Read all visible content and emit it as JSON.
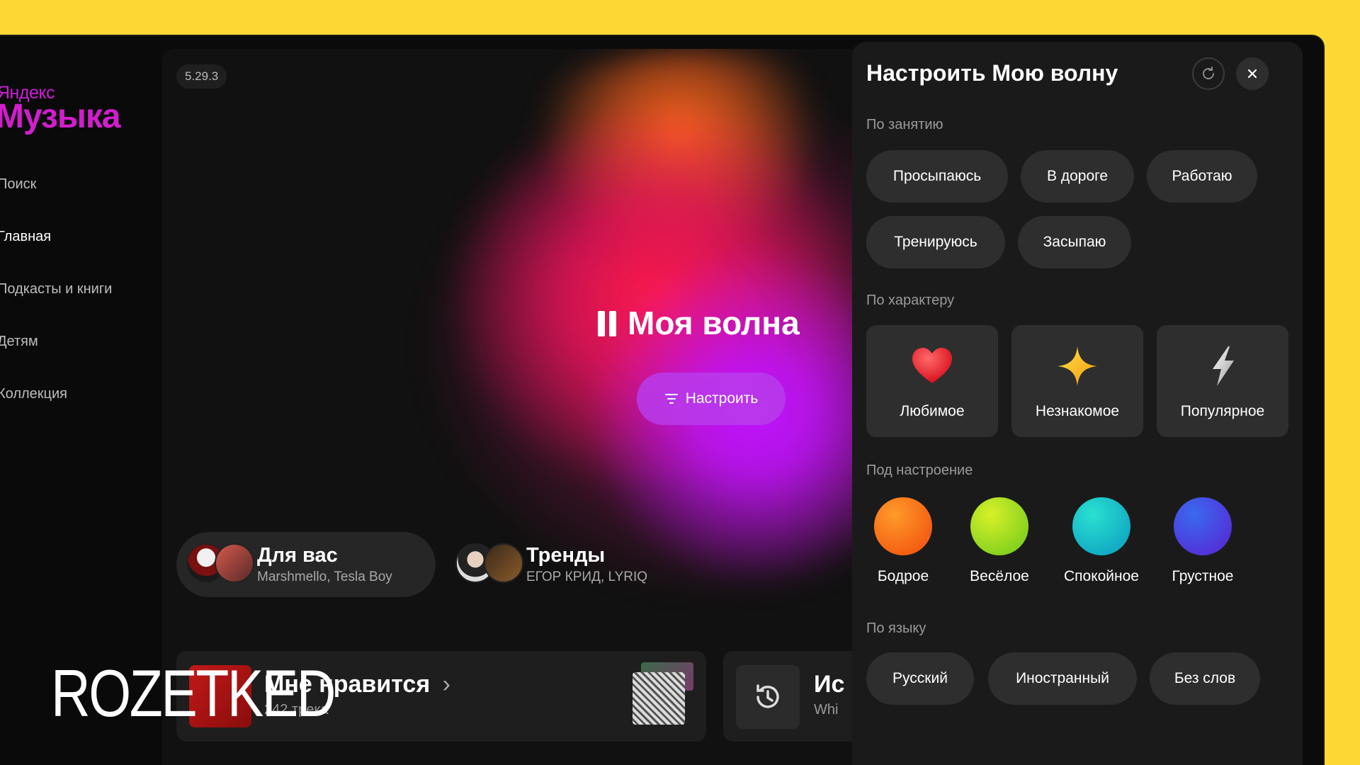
{
  "app": {
    "logo_top": "Яндекс",
    "logo_bottom": "Музыка",
    "version": "5.29.3"
  },
  "sidebar": {
    "items": [
      {
        "label": "Поиск",
        "active": false
      },
      {
        "label": "Главная",
        "active": true
      },
      {
        "label": "Подкасты и книги",
        "active": false
      },
      {
        "label": "Детям",
        "active": false
      },
      {
        "label": "Коллекция",
        "active": false
      }
    ]
  },
  "main": {
    "wave_title": "Моя волна",
    "tune_label": "Настроить",
    "for_you": {
      "title": "Для вас",
      "subtitle": "Marshmello, Tesla Boy"
    },
    "trends": {
      "title": "Тренды",
      "subtitle": "ЕГОР КРИД, LYRIQ"
    },
    "liked": {
      "title": "Мне нравится",
      "subtitle": "242 трека"
    },
    "history": {
      "title": "Ис",
      "subtitle": "Whi"
    }
  },
  "panel": {
    "title": "Настроить Мою волну",
    "sections": {
      "activity": {
        "label": "По занятию",
        "items": [
          "Просыпаюсь",
          "В дороге",
          "Работаю",
          "Тренируюсь",
          "Засыпаю"
        ]
      },
      "character": {
        "label": "По характеру",
        "items": [
          {
            "label": "Любимое",
            "icon": "heart-icon"
          },
          {
            "label": "Незнакомое",
            "icon": "sparkle-icon"
          },
          {
            "label": "Популярное",
            "icon": "lightning-icon"
          }
        ]
      },
      "mood": {
        "label": "Под настроение",
        "items": [
          {
            "label": "Бодрое",
            "color": "#ff7a00"
          },
          {
            "label": "Весёлое",
            "color": "#a5e01a"
          },
          {
            "label": "Спокойное",
            "color": "#12c2c9"
          },
          {
            "label": "Грустное",
            "color": "#4a3fe0"
          }
        ]
      },
      "language": {
        "label": "По языку",
        "items": [
          "Русский",
          "Иностранный",
          "Без слов"
        ]
      }
    }
  },
  "watermark": "ROZETKED",
  "colors": {
    "background": "#fdd835",
    "brand": "#d11ecc"
  }
}
